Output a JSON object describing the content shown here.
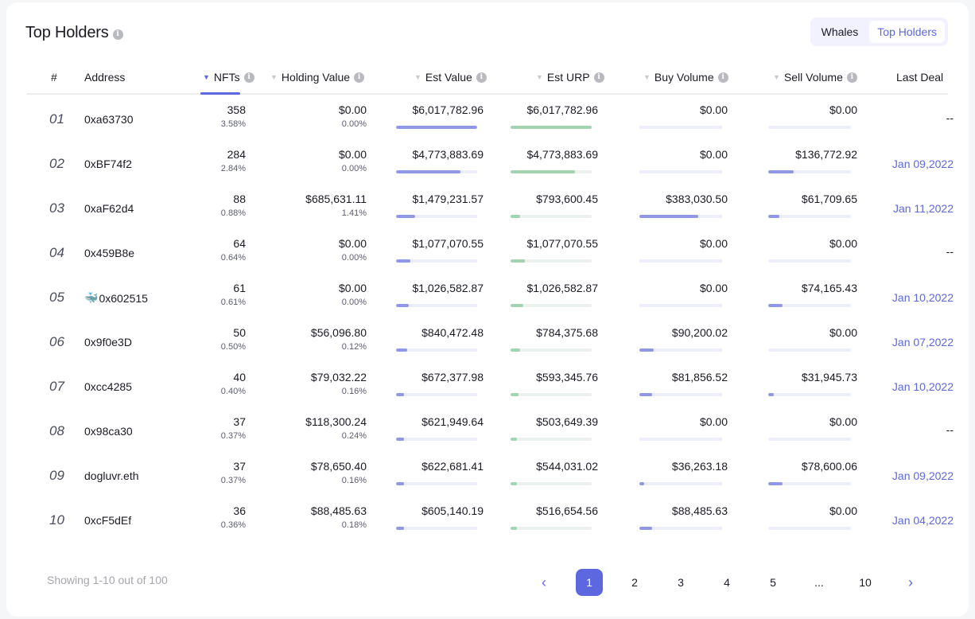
{
  "header": {
    "title": "Top Holders",
    "info_icon": "info-icon",
    "toggle": [
      {
        "label": "Whales",
        "active": false
      },
      {
        "label": "Top Holders",
        "active": true
      }
    ]
  },
  "columns": [
    {
      "key": "rank",
      "label": "#"
    },
    {
      "key": "address",
      "label": "Address"
    },
    {
      "key": "nfts",
      "label": "NFTs",
      "sortable": true,
      "sorted": true,
      "info": true
    },
    {
      "key": "holding_value",
      "label": "Holding Value",
      "sortable": true,
      "info": true
    },
    {
      "key": "est_value",
      "label": "Est Value",
      "sortable": true,
      "info": true
    },
    {
      "key": "est_urp",
      "label": "Est URP",
      "sortable": true,
      "info": true
    },
    {
      "key": "buy_volume",
      "label": "Buy Volume",
      "sortable": true,
      "info": true
    },
    {
      "key": "sell_volume",
      "label": "Sell Volume",
      "sortable": true,
      "info": true
    },
    {
      "key": "last_deal",
      "label": "Last Deal"
    }
  ],
  "rows": [
    {
      "rank": "01",
      "address": "0xa63730",
      "whale": false,
      "nfts": "358",
      "nfts_pct": "3.58%",
      "holding_value": "$0.00",
      "holding_pct": "0.00%",
      "est_value": "$6,017,782.96",
      "est_value_bar": 1.0,
      "est_urp": "$6,017,782.96",
      "est_urp_bar": 1.0,
      "buy_volume": "$0.00",
      "buy_bar": 0.0,
      "sell_volume": "$0.00",
      "sell_bar": 0.0,
      "last_deal": "--"
    },
    {
      "rank": "02",
      "address": "0xBF74f2",
      "whale": false,
      "nfts": "284",
      "nfts_pct": "2.84%",
      "holding_value": "$0.00",
      "holding_pct": "0.00%",
      "est_value": "$4,773,883.69",
      "est_value_bar": 0.79,
      "est_urp": "$4,773,883.69",
      "est_urp_bar": 0.79,
      "buy_volume": "$0.00",
      "buy_bar": 0.0,
      "sell_volume": "$136,772.92",
      "sell_bar": 0.31,
      "last_deal": "Jan 09,2022"
    },
    {
      "rank": "03",
      "address": "0xaF62d4",
      "whale": false,
      "nfts": "88",
      "nfts_pct": "0.88%",
      "holding_value": "$685,631.11",
      "holding_pct": "1.41%",
      "est_value": "$1,479,231.57",
      "est_value_bar": 0.24,
      "est_urp": "$793,600.45",
      "est_urp_bar": 0.12,
      "buy_volume": "$383,030.50",
      "buy_bar": 0.71,
      "sell_volume": "$61,709.65",
      "sell_bar": 0.13,
      "last_deal": "Jan 11,2022"
    },
    {
      "rank": "04",
      "address": "0x459B8e",
      "whale": false,
      "nfts": "64",
      "nfts_pct": "0.64%",
      "holding_value": "$0.00",
      "holding_pct": "0.00%",
      "est_value": "$1,077,070.55",
      "est_value_bar": 0.18,
      "est_urp": "$1,077,070.55",
      "est_urp_bar": 0.18,
      "buy_volume": "$0.00",
      "buy_bar": 0.0,
      "sell_volume": "$0.00",
      "sell_bar": 0.0,
      "last_deal": "--"
    },
    {
      "rank": "05",
      "address": "0x602515",
      "whale": true,
      "nfts": "61",
      "nfts_pct": "0.61%",
      "holding_value": "$0.00",
      "holding_pct": "0.00%",
      "est_value": "$1,026,582.87",
      "est_value_bar": 0.16,
      "est_urp": "$1,026,582.87",
      "est_urp_bar": 0.16,
      "buy_volume": "$0.00",
      "buy_bar": 0.0,
      "sell_volume": "$74,165.43",
      "sell_bar": 0.17,
      "last_deal": "Jan 10,2022"
    },
    {
      "rank": "06",
      "address": "0x9f0e3D",
      "whale": false,
      "nfts": "50",
      "nfts_pct": "0.50%",
      "holding_value": "$56,096.80",
      "holding_pct": "0.12%",
      "est_value": "$840,472.48",
      "est_value_bar": 0.14,
      "est_urp": "$784,375.68",
      "est_urp_bar": 0.12,
      "buy_volume": "$90,200.02",
      "buy_bar": 0.17,
      "sell_volume": "$0.00",
      "sell_bar": 0.0,
      "last_deal": "Jan 07,2022"
    },
    {
      "rank": "07",
      "address": "0xcc4285",
      "whale": false,
      "nfts": "40",
      "nfts_pct": "0.40%",
      "holding_value": "$79,032.22",
      "holding_pct": "0.16%",
      "est_value": "$672,377.98",
      "est_value_bar": 0.1,
      "est_urp": "$593,345.76",
      "est_urp_bar": 0.1,
      "buy_volume": "$81,856.52",
      "buy_bar": 0.15,
      "sell_volume": "$31,945.73",
      "sell_bar": 0.07,
      "last_deal": "Jan 10,2022"
    },
    {
      "rank": "08",
      "address": "0x98ca30",
      "whale": false,
      "nfts": "37",
      "nfts_pct": "0.37%",
      "holding_value": "$118,300.24",
      "holding_pct": "0.24%",
      "est_value": "$621,949.64",
      "est_value_bar": 0.1,
      "est_urp": "$503,649.39",
      "est_urp_bar": 0.08,
      "buy_volume": "$0.00",
      "buy_bar": 0.0,
      "sell_volume": "$0.00",
      "sell_bar": 0.0,
      "last_deal": "--"
    },
    {
      "rank": "09",
      "address": "dogluvr.eth",
      "whale": false,
      "nfts": "37",
      "nfts_pct": "0.37%",
      "holding_value": "$78,650.40",
      "holding_pct": "0.16%",
      "est_value": "$622,681.41",
      "est_value_bar": 0.1,
      "est_urp": "$544,031.02",
      "est_urp_bar": 0.08,
      "buy_volume": "$36,263.18",
      "buy_bar": 0.06,
      "sell_volume": "$78,600.06",
      "sell_bar": 0.17,
      "last_deal": "Jan 09,2022"
    },
    {
      "rank": "10",
      "address": "0xcF5dEf",
      "whale": false,
      "nfts": "36",
      "nfts_pct": "0.36%",
      "holding_value": "$88,485.63",
      "holding_pct": "0.18%",
      "est_value": "$605,140.19",
      "est_value_bar": 0.1,
      "est_urp": "$516,654.56",
      "est_urp_bar": 0.08,
      "buy_volume": "$88,485.63",
      "buy_bar": 0.15,
      "sell_volume": "$0.00",
      "sell_bar": 0.0,
      "last_deal": "Jan 04,2022"
    }
  ],
  "footer": {
    "showing": "Showing 1-10 out of 100",
    "pagination": {
      "prev_icon": "‹",
      "next_icon": "›",
      "pages": [
        "1",
        "2",
        "3",
        "4",
        "5",
        "...",
        "10"
      ],
      "current": "1"
    }
  },
  "colors": {
    "accent": "#5c67e0",
    "bar_purple": "#9198e5",
    "bar_green": "#a3d4b1"
  }
}
